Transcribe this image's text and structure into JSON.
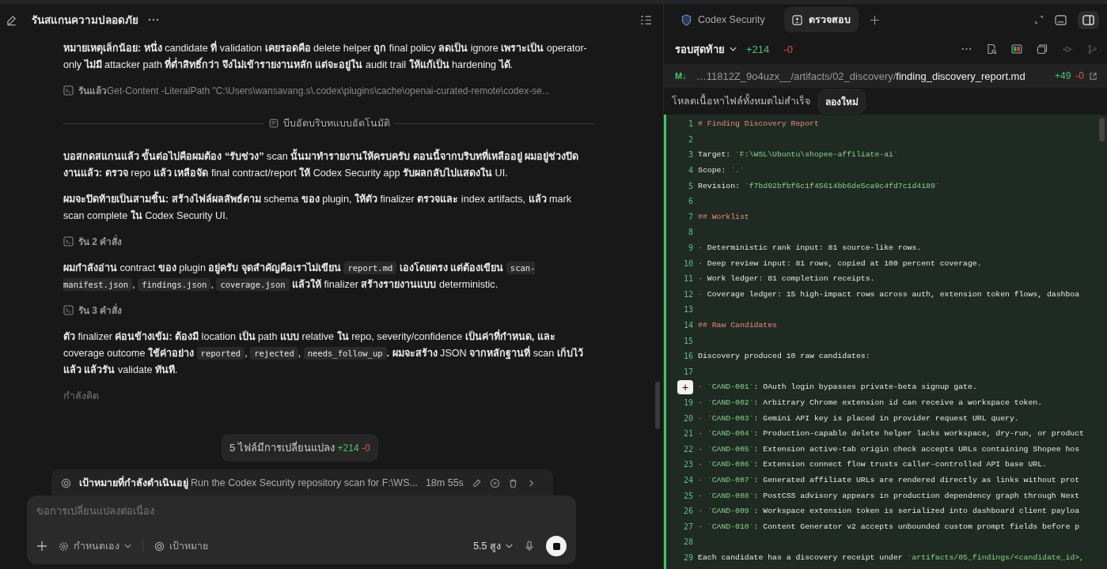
{
  "chat": {
    "title": "รันสแกนความปลอดภัย",
    "items": [
      {
        "kind": "paragraph",
        "segments": [
          {
            "kind": "text",
            "text": "**หมายเหตุเล็กน้อย: หนึ่ง** candidate **ที่** validation **เคยรอดคือ** delete helper **ถูก** final policy **ลดเป็น** ignore **เพราะเป็น** operator-only **ไม่มี** attacker path **ที่ต่ำสิทธิ์กว่า จึงไม่เข้ารายงานหลัก แต่จะอยู่ใน** audit trail **ให้แก้เป็น** hardening **ได้**."
          }
        ]
      },
      {
        "kind": "command",
        "label": "รันแล้ว",
        "detail": "Get-Content -LiteralPath \"C:\\Users\\wansavang.s\\.codex\\plugins\\cache\\openai-curated-remote\\codex-se..."
      },
      {
        "kind": "divider",
        "label": "บีบอัดบริบทแบบอัตโนมัติ"
      },
      {
        "kind": "paragraph",
        "segments": [
          {
            "kind": "text",
            "text": "**บอสกดสแกนแล้ว ขั้นต่อไปคือผมต้อง “รับช่วง”** scan **นั้นมาทำรายงานให้ครบครับ ตอนนี้จากบริบทที่เหลืออยู่ ผมอยู่ช่วงปิดงานแล้ว: ตรวจ** repo **แล้ว เหลือจัด** final contract/report **ให้** Codex Security app **รับผลกลับไปแสดงใน** UI."
          }
        ]
      },
      {
        "kind": "paragraph",
        "segments": [
          {
            "kind": "text",
            "text": "**ผมจะปิดท้ายเป็นสามชิ้น: สร้างไฟล์ผลลัพธ์ตาม** schema **ของ** plugin, **ให้ตัว** finalizer **ตรวจและ** index artifacts, **แล้ว** mark scan complete **ใน** Codex Security UI."
          }
        ]
      },
      {
        "kind": "command",
        "label": "รัน 2 คำสั่ง"
      },
      {
        "kind": "paragraph",
        "segments": [
          {
            "kind": "text",
            "text": "**ผมกำลังอ่าน** contract **ของ** plugin **อยู่ครับ จุดสำคัญคือเราไม่เขียน** "
          },
          {
            "kind": "code",
            "text": "report.md"
          },
          {
            "kind": "text",
            "text": " **เองโดยตรง แต่ต้องเขียน** "
          },
          {
            "kind": "code",
            "text": "scan-manifest.json"
          },
          {
            "kind": "text",
            "text": ", "
          },
          {
            "kind": "code",
            "text": "findings.json"
          },
          {
            "kind": "text",
            "text": ", "
          },
          {
            "kind": "code",
            "text": "coverage.json"
          },
          {
            "kind": "text",
            "text": " **แล้วให้** finalizer **สร้างรายงานแบบ** deterministic."
          }
        ]
      },
      {
        "kind": "command",
        "label": "รัน 3 คำสั่ง"
      },
      {
        "kind": "paragraph",
        "segments": [
          {
            "kind": "text",
            "text": "**ตัว** finalizer **ค่อนข้างเข้ม: ต้องมี** location **เป็น** path **แบบ** relative **ใน** repo, severity/confidence **เป็นค่าที่กำหนด, และ** coverage outcome **ใช้ค่าอย่าง** "
          },
          {
            "kind": "code",
            "text": "reported"
          },
          {
            "kind": "text",
            "text": ", "
          },
          {
            "kind": "code",
            "text": "rejected"
          },
          {
            "kind": "text",
            "text": ", "
          },
          {
            "kind": "code",
            "text": "needs_follow_up"
          },
          {
            "kind": "text",
            "text": "**. ผมจะสร้าง** JSON **จากหลักฐานที่** scan **เก็บไว้แล้ว แล้วรัน** validate **ทันที**."
          }
        ]
      },
      {
        "kind": "status",
        "text": "กำลังคิด"
      }
    ],
    "changes": {
      "label": "5 ไฟล์มีการเปลี่ยนแปลง",
      "added": "+214",
      "removed": "-0"
    },
    "goal": {
      "label": "เป้าหมายที่กำลังดำเนินอยู่",
      "text": "Run the Codex Security repository scan for F:\\WS...",
      "elapsed": "18m 55s"
    },
    "composer": {
      "placeholder": "ขอการเปลี่ยนแปลงต่อเนื่อง",
      "mode": "กำหนดเอง",
      "goal_button": "เป้าหมาย",
      "model": "5.5 สูง"
    }
  },
  "review": {
    "tabs": [
      {
        "kind": "extension",
        "label": "Codex Security",
        "selected": false
      },
      {
        "kind": "review",
        "label": "ตรวจสอบ",
        "selected": true
      }
    ],
    "scope": "รอบสุดท้าย",
    "added": "+214",
    "removed": "-0",
    "file": {
      "badge": "M↓",
      "dir": "…11812Z_9o4uzx__/artifacts/02_discovery/",
      "name": "finding_discovery_report.md",
      "added": "+49",
      "removed": "-0"
    },
    "notice": "โหลดเนื้อหาไฟล์ทั้งหมดไม่สำเร็จ",
    "retry": "ลองใหม่",
    "lines": [
      {
        "number": "1",
        "parts": [
          {
            "kind": "heading",
            "text": "# Finding Discovery Report"
          }
        ]
      },
      {
        "number": "2"
      },
      {
        "number": "3",
        "parts": [
          {
            "kind": "plain",
            "text": "Target: "
          },
          {
            "kind": "code",
            "text": "`F:\\WSL\\Ubuntu\\shopee-affiliate-ai`"
          }
        ]
      },
      {
        "number": "4",
        "parts": [
          {
            "kind": "plain",
            "text": "Scope: "
          },
          {
            "kind": "code",
            "text": "`.`"
          }
        ]
      },
      {
        "number": "5",
        "parts": [
          {
            "kind": "plain",
            "text": "Revision: "
          },
          {
            "kind": "code",
            "text": "`f7bd92bfbf6c1f45614bb6de5ca9c4fd7c1d4189`"
          }
        ]
      },
      {
        "number": "6"
      },
      {
        "number": "7",
        "parts": [
          {
            "kind": "heading",
            "text": "## Worklist"
          }
        ]
      },
      {
        "number": "8"
      },
      {
        "number": "9",
        "parts": [
          {
            "kind": "dash",
            "text": "- "
          },
          {
            "kind": "plain",
            "text": "Deterministic rank input: 81 source-like rows."
          }
        ]
      },
      {
        "number": "10",
        "parts": [
          {
            "kind": "dash",
            "text": "- "
          },
          {
            "kind": "plain",
            "text": "Deep review input: 81 rows, copied at 100 percent coverage."
          }
        ]
      },
      {
        "number": "11",
        "parts": [
          {
            "kind": "dash",
            "text": "- "
          },
          {
            "kind": "plain",
            "text": "Work ledger: 81 completion receipts."
          }
        ]
      },
      {
        "number": "12",
        "parts": [
          {
            "kind": "dash",
            "text": "- "
          },
          {
            "kind": "plain",
            "text": "Coverage ledger: 15 high-impact rows across auth, extension token flows, dashboa"
          }
        ]
      },
      {
        "number": "13"
      },
      {
        "number": "14",
        "parts": [
          {
            "kind": "heading",
            "text": "## Raw Candidates"
          }
        ]
      },
      {
        "number": "15"
      },
      {
        "number": "16",
        "parts": [
          {
            "kind": "plain",
            "text": "Discovery produced 10 raw candidates:"
          }
        ]
      },
      {
        "number": "17"
      },
      {
        "comment_button": "+",
        "parts": [
          {
            "kind": "dash",
            "text": "- "
          },
          {
            "kind": "code",
            "text": "`CAND-001`"
          },
          {
            "kind": "plain",
            "text": ": OAuth login bypasses private-beta signup gate."
          }
        ]
      },
      {
        "number": "19",
        "parts": [
          {
            "kind": "dash",
            "text": "- "
          },
          {
            "kind": "code",
            "text": "`CAND-002`"
          },
          {
            "kind": "plain",
            "text": ": Arbitrary Chrome extension id can receive a workspace token."
          }
        ]
      },
      {
        "number": "20",
        "parts": [
          {
            "kind": "dash",
            "text": "- "
          },
          {
            "kind": "code",
            "text": "`CAND-003`"
          },
          {
            "kind": "plain",
            "text": ": Gemini API key is placed in provider request URL query."
          }
        ]
      },
      {
        "number": "21",
        "parts": [
          {
            "kind": "dash",
            "text": "- "
          },
          {
            "kind": "code",
            "text": "`CAND-004`"
          },
          {
            "kind": "plain",
            "text": ": Production-capable delete helper lacks workspace, dry-run, or product"
          }
        ]
      },
      {
        "number": "22",
        "parts": [
          {
            "kind": "dash",
            "text": "- "
          },
          {
            "kind": "code",
            "text": "`CAND-005`"
          },
          {
            "kind": "plain",
            "text": ": Extension active-tab origin check accepts URLs containing Shopee hos"
          }
        ]
      },
      {
        "number": "23",
        "parts": [
          {
            "kind": "dash",
            "text": "- "
          },
          {
            "kind": "code",
            "text": "`CAND-006`"
          },
          {
            "kind": "plain",
            "text": ": Extension connect flow trusts caller-controlled API base URL."
          }
        ]
      },
      {
        "number": "24",
        "parts": [
          {
            "kind": "dash",
            "text": "- "
          },
          {
            "kind": "code",
            "text": "`CAND-007`"
          },
          {
            "kind": "plain",
            "text": ": Generated affiliate URLs are rendered directly as links without prot"
          }
        ]
      },
      {
        "number": "25",
        "parts": [
          {
            "kind": "dash",
            "text": "- "
          },
          {
            "kind": "code",
            "text": "`CAND-008`"
          },
          {
            "kind": "plain",
            "text": ": PostCSS advisory appears in production dependency graph through Next"
          }
        ]
      },
      {
        "number": "26",
        "parts": [
          {
            "kind": "dash",
            "text": "- "
          },
          {
            "kind": "code",
            "text": "`CAND-009`"
          },
          {
            "kind": "plain",
            "text": ": Workspace extension token is serialized into dashboard client payloa"
          }
        ]
      },
      {
        "number": "27",
        "parts": [
          {
            "kind": "dash",
            "text": "- "
          },
          {
            "kind": "code",
            "text": "`CAND-010`"
          },
          {
            "kind": "plain",
            "text": ": Content Generator v2 accepts unbounded custom prompt fields before p"
          }
        ]
      },
      {
        "number": "28"
      },
      {
        "number": "29",
        "parts": [
          {
            "kind": "plain",
            "text": "Each candidate has a discovery receipt under "
          },
          {
            "kind": "code",
            "text": "`artifacts/05_findings/<candidate_id>,"
          }
        ]
      }
    ]
  }
}
